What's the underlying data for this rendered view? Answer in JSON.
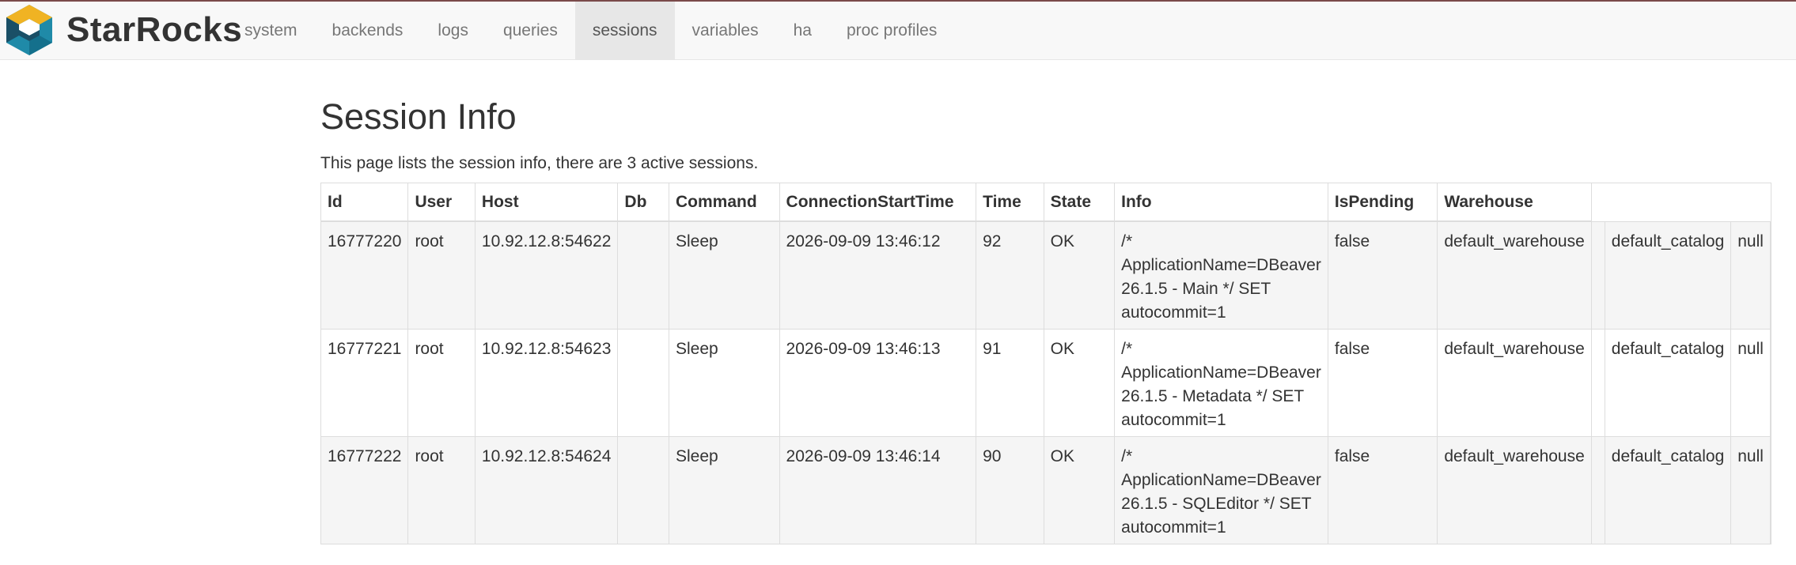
{
  "brand": {
    "name": "StarRocks"
  },
  "nav": {
    "items": [
      {
        "label": "system"
      },
      {
        "label": "backends"
      },
      {
        "label": "logs"
      },
      {
        "label": "queries"
      },
      {
        "label": "sessions"
      },
      {
        "label": "variables"
      },
      {
        "label": "ha"
      },
      {
        "label": "proc profiles"
      }
    ],
    "active": "sessions"
  },
  "page": {
    "title": "Session Info",
    "description": "This page lists the session info, there are 3 active sessions."
  },
  "table": {
    "headers": [
      "Id",
      "User",
      "Host",
      "Db",
      "Command",
      "ConnectionStartTime",
      "Time",
      "State",
      "Info",
      "IsPending",
      "Warehouse"
    ],
    "rows": [
      [
        "16777220",
        "root",
        "10.92.12.8:54622",
        "",
        "Sleep",
        "2026-09-09 13:46:12",
        "92",
        "OK",
        "/* ApplicationName=DBeaver 26.1.5 - Main */ SET autocommit=1",
        "false",
        "default_warehouse",
        "",
        "default_catalog",
        "null"
      ],
      [
        "16777221",
        "root",
        "10.92.12.8:54623",
        "",
        "Sleep",
        "2026-09-09 13:46:13",
        "91",
        "OK",
        "/* ApplicationName=DBeaver 26.1.5 - Metadata */ SET autocommit=1",
        "false",
        "default_warehouse",
        "",
        "default_catalog",
        "null"
      ],
      [
        "16777222",
        "root",
        "10.92.12.8:54624",
        "",
        "Sleep",
        "2026-09-09 13:46:14",
        "90",
        "OK",
        "/* ApplicationName=DBeaver 26.1.5 - SQLEditor */ SET autocommit=1",
        "false",
        "default_warehouse",
        "",
        "default_catalog",
        "null"
      ]
    ]
  },
  "colors": {
    "navbar_bg": "#f8f8f8",
    "nav_active_bg": "#e7e7e7",
    "stripe_bg": "#f5f5f5",
    "logo_teal": "#1f8aa8",
    "logo_dark": "#1a4f66",
    "logo_yellow": "#f0b323"
  },
  "icons": {
    "logo": "starrocks-logo"
  }
}
